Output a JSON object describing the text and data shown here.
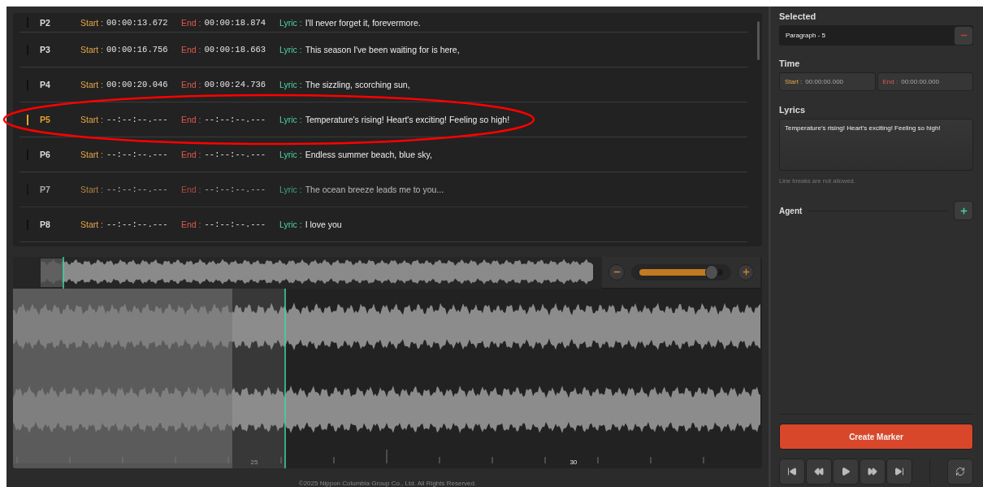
{
  "paragraphs": [
    {
      "label": "P2",
      "start_label": "Start :",
      "start": "00:00:13.672",
      "end_label": "End :",
      "end": "00:00:18.874",
      "lyric_label": "Lyric :",
      "lyric": "I'll never forget it, forevermore.",
      "selected": false,
      "disabled": false,
      "circled": false
    },
    {
      "label": "P3",
      "start_label": "Start :",
      "start": "00:00:16.756",
      "end_label": "End :",
      "end": "00:00:18.663",
      "lyric_label": "Lyric :",
      "lyric": "This season I've been waiting for is here,",
      "selected": false,
      "disabled": false,
      "circled": false
    },
    {
      "label": "P4",
      "start_label": "Start :",
      "start": "00:00:20.046",
      "end_label": "End :",
      "end": "00:00:24.736",
      "lyric_label": "Lyric :",
      "lyric": "The sizzling, scorching sun,",
      "selected": false,
      "disabled": false,
      "circled": false
    },
    {
      "label": "P5",
      "start_label": "Start :",
      "start": "--:--:--.---",
      "end_label": "End :",
      "end": "--:--:--.---",
      "lyric_label": "Lyric :",
      "lyric": "Temperature's rising! Heart's exciting! Feeling so high!",
      "selected": true,
      "disabled": false,
      "circled": true
    },
    {
      "label": "P6",
      "start_label": "Start :",
      "start": "--:--:--.---",
      "end_label": "End :",
      "end": "--:--:--.---",
      "lyric_label": "Lyric :",
      "lyric": "Endless summer beach, blue sky,",
      "selected": false,
      "disabled": false,
      "circled": false
    },
    {
      "label": "P7",
      "start_label": "Start :",
      "start": "--:--:--.---",
      "end_label": "End :",
      "end": "--:--:--.---",
      "lyric_label": "Lyric :",
      "lyric": "The ocean breeze leads me to you...",
      "selected": false,
      "disabled": true,
      "circled": false
    },
    {
      "label": "P8",
      "start_label": "Start :",
      "start": "--:--:--.---",
      "end_label": "End :",
      "end": "--:--:--.---",
      "lyric_label": "Lyric :",
      "lyric": "I love you",
      "selected": false,
      "disabled": false,
      "circled": false
    }
  ],
  "zoom": {
    "level": 0.86
  },
  "ruler_labels": [
    "25",
    "30"
  ],
  "footer": "©2025 Nippon Columbia Group Co., Ltd. All Rights Reserved.",
  "panel": {
    "selected_title": "Selected",
    "selected_value": "Paragraph - 5",
    "time_title": "Time",
    "start_label": "Start :",
    "start": "00:00:00.000",
    "end_label": "End :",
    "end": "00:00:00.000",
    "lyrics_title": "Lyrics",
    "lyrics": "Temperature's rising! Heart's exciting! Feeling so high!",
    "hint": "Line breaks are not allowed.",
    "agent_title": "Agent",
    "create_button": "Create Marker"
  }
}
